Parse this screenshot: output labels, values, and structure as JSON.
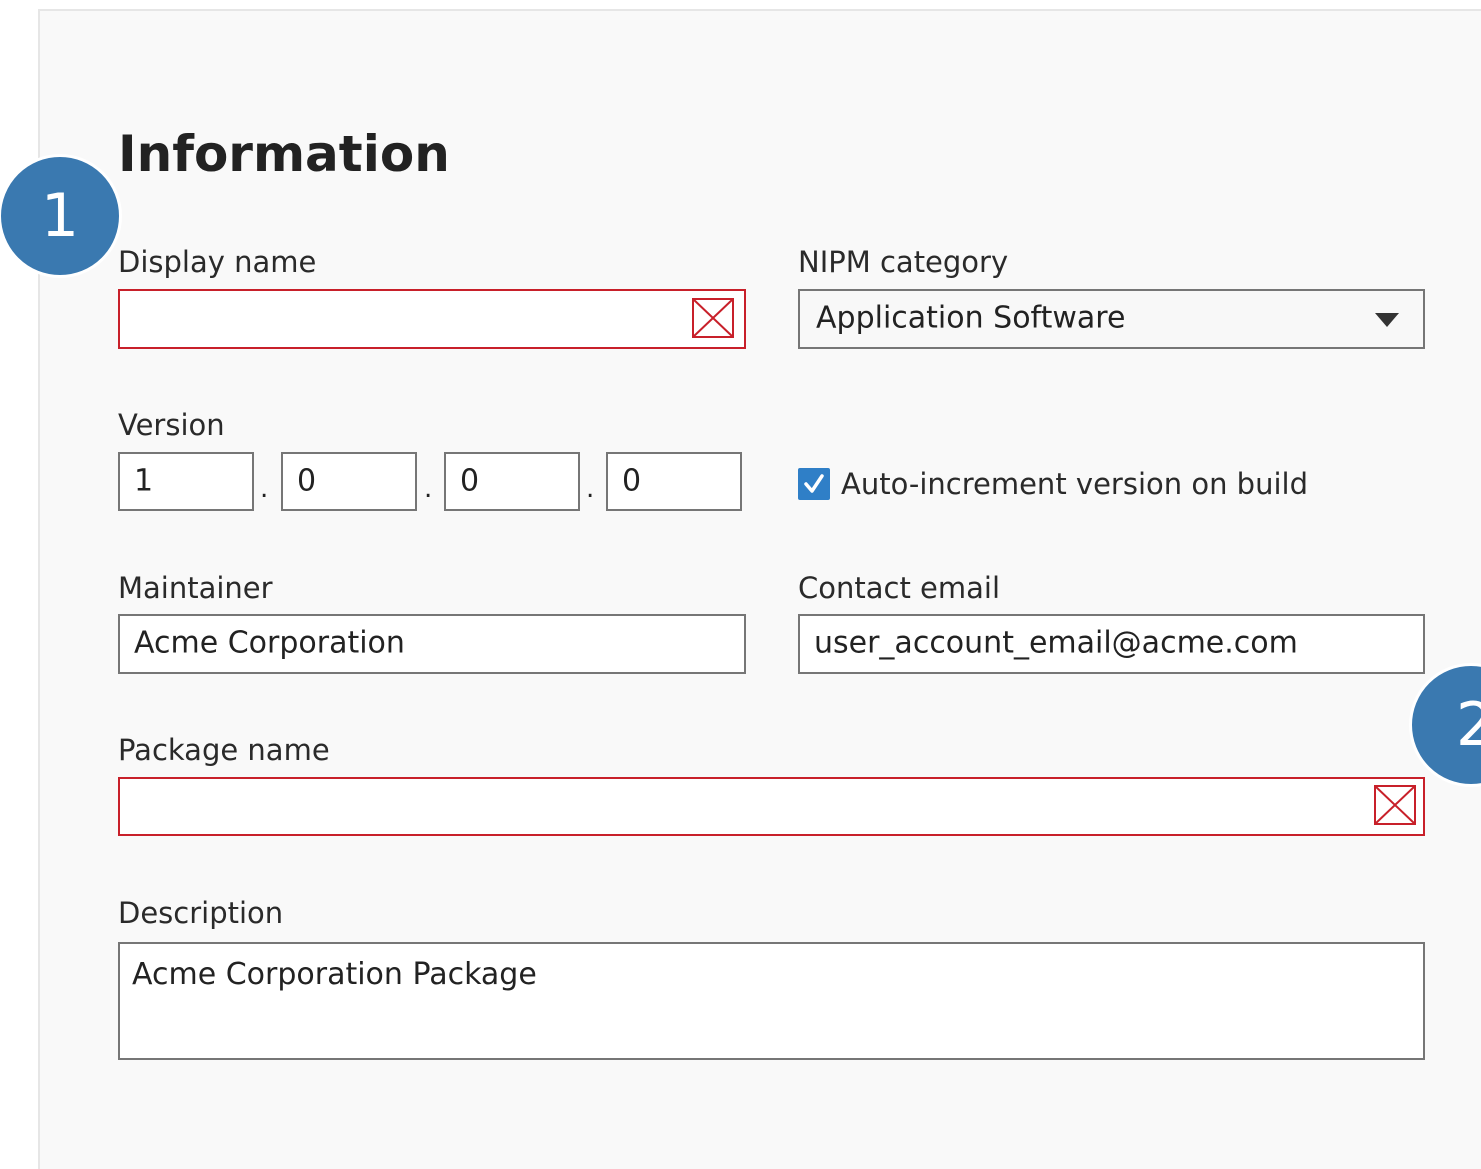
{
  "section": {
    "title": "Information"
  },
  "callouts": [
    "1",
    "2"
  ],
  "display_name": {
    "label": "Display name",
    "value": "",
    "state": "error"
  },
  "nipm_category": {
    "label": "NIPM category",
    "selected": "Application Software"
  },
  "version": {
    "label": "Version",
    "parts": [
      "1",
      "0",
      "0",
      "0"
    ],
    "separator": "."
  },
  "auto_increment": {
    "label": "Auto-increment version on build",
    "checked": true
  },
  "maintainer": {
    "label": "Maintainer",
    "value": "Acme Corporation"
  },
  "contact_email": {
    "label": "Contact email",
    "value": "user_account_email@acme.com"
  },
  "package_name": {
    "label": "Package name",
    "value": "",
    "state": "error"
  },
  "description": {
    "label": "Description",
    "value": "Acme Corporation Package"
  },
  "colors": {
    "error_border": "#c8202a",
    "accent": "#2f7fc7",
    "callout": "#3a79b0",
    "field_border": "#767676"
  }
}
